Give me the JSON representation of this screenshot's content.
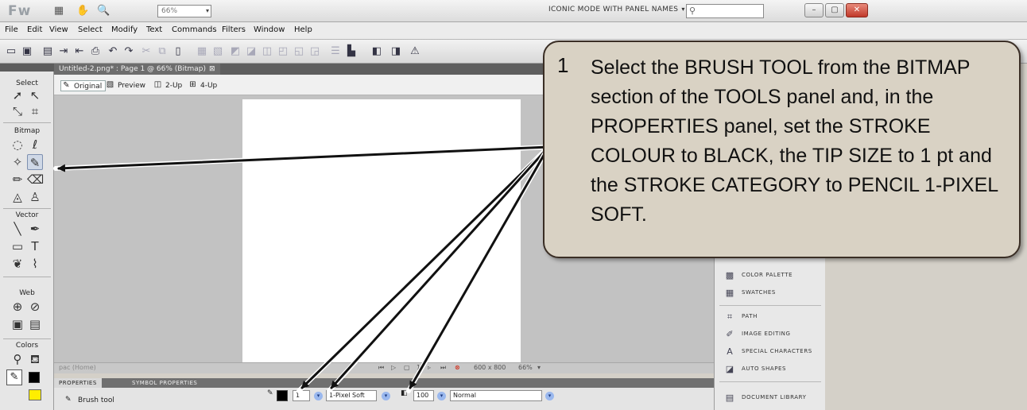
{
  "app": {
    "logo": "Fw",
    "zoom": "66%",
    "workspace": "ICONIC MODE WITH PANEL NAMES",
    "search_icon": "search-icon"
  },
  "menu": [
    "File",
    "Edit",
    "View",
    "Select",
    "Modify",
    "Text",
    "Commands",
    "Filters",
    "Window",
    "Help"
  ],
  "document": {
    "tab_title": "Untitled-2.png* : Page 1 @ 66% (Bitmap)",
    "views": [
      "Original",
      "Preview",
      "2-Up",
      "4-Up"
    ],
    "canvas_size": "600 x 800",
    "zoom": "66%",
    "page_number": "1",
    "page_label": "pac (Home)"
  },
  "tools": {
    "sections": [
      "Select",
      "Bitmap",
      "Vector",
      "Web",
      "Colors"
    ]
  },
  "properties": {
    "tabs": [
      "PROPERTIES",
      "SYMBOL PROPERTIES"
    ],
    "tool_name": "Brush tool",
    "tip_size": "1",
    "stroke_category": "1-Pixel Soft",
    "opacity": "100",
    "blend_mode": "Normal",
    "stroke_color": "#000000"
  },
  "right_panels": {
    "items": [
      "COLOR PALETTE",
      "SWATCHES",
      "PATH",
      "IMAGE EDITING",
      "SPECIAL CHARACTERS",
      "AUTO SHAPES",
      "DOCUMENT LIBRARY"
    ]
  },
  "callout": {
    "number": "1",
    "text": "Select the BRUSH TOOL from the BITMAP section of the TOOLS panel and, in the PROPERTIES panel, set the STROKE COLOUR to BLACK, the TIP SIZE to 1 pt and the STROKE CATEGORY to PENCIL 1-PIXEL SOFT."
  },
  "colors": {
    "callout_fill": "#d9d2c4",
    "callout_border": "#3a2e25",
    "accent_yellow": "#ffee00"
  }
}
